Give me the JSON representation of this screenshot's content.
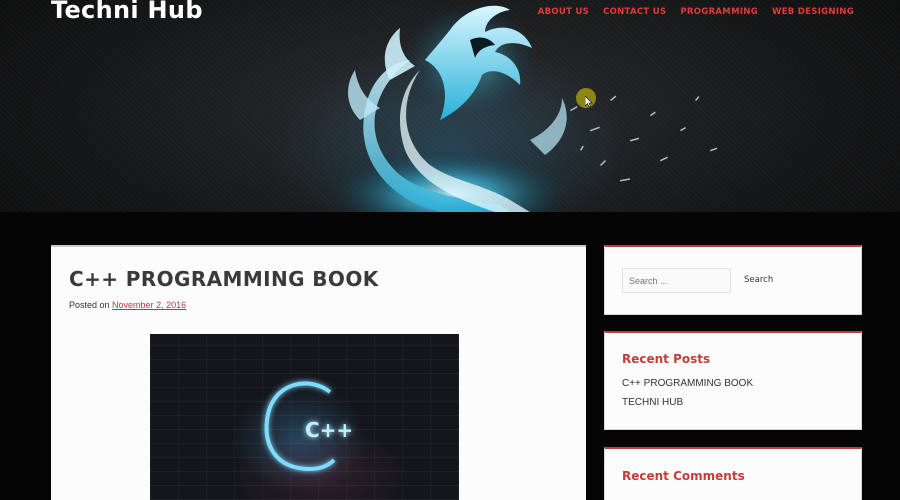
{
  "site": {
    "title": "Techni Hub"
  },
  "nav": [
    "ABOUT US",
    "CONTACT US",
    "PROGRAMMING",
    "WEB DESIGNING"
  ],
  "post": {
    "title": "C++ PROGRAMMING BOOK",
    "meta_prefix": "Posted on",
    "date": "November 2, 2016",
    "image_text": "C++"
  },
  "sidebar": {
    "search_placeholder": "Search ...",
    "search_button": "Search",
    "recent_posts": {
      "title": "Recent Posts",
      "items": [
        "C++ PROGRAMMING BOOK",
        "TECHNI HUB"
      ]
    },
    "recent_comments": {
      "title": "Recent Comments"
    }
  },
  "colors": {
    "accent": "#c43c3c",
    "nav": "#e23a3a",
    "background": "#050505"
  },
  "icons": [
    "dragon-header-image",
    "mouse-cursor-icon"
  ]
}
